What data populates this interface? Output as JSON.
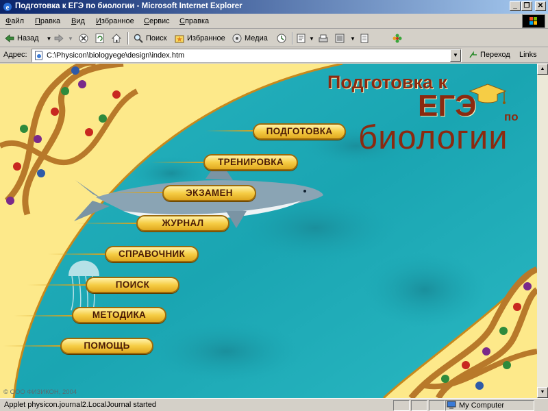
{
  "window": {
    "title": "Подготовка к ЕГЭ по биологии - Microsoft Internet Explorer"
  },
  "menu": [
    {
      "label": "Файл"
    },
    {
      "label": "Правка"
    },
    {
      "label": "Вид"
    },
    {
      "label": "Избранное"
    },
    {
      "label": "Сервис"
    },
    {
      "label": "Справка"
    }
  ],
  "toolbar": {
    "back": "Назад",
    "search": "Поиск",
    "favorites": "Избранное",
    "media": "Медиа"
  },
  "address": {
    "label": "Адрес:",
    "url": "C:\\Physicon\\biologyege\\design\\index.htm",
    "go": "Переход",
    "links": "Links"
  },
  "logo": {
    "line1": "Подготовка к",
    "line2": "ЕГЭ",
    "line3": "по",
    "line4": "биологии"
  },
  "nav": [
    {
      "label": "ПОДГОТОВКА"
    },
    {
      "label": "ТРЕНИРОВКА"
    },
    {
      "label": "ЭКЗАМЕН"
    },
    {
      "label": "ЖУРНАЛ"
    },
    {
      "label": "СПРАВОЧНИК"
    },
    {
      "label": "ПОИСК"
    },
    {
      "label": "МЕТОДИКА"
    },
    {
      "label": "ПОМОЩЬ"
    }
  ],
  "copyright": "© ООО ФИЗИКОН, 2004",
  "status": {
    "text": "Applet physicon.journal2.LocalJournal started",
    "zone": "My Computer"
  },
  "colors": {
    "titlebar": "#0a246a",
    "content_bg": "#fde98a",
    "water": "#1eaab5",
    "button_text": "#4a1a06",
    "logo_text": "#8b2a10"
  }
}
